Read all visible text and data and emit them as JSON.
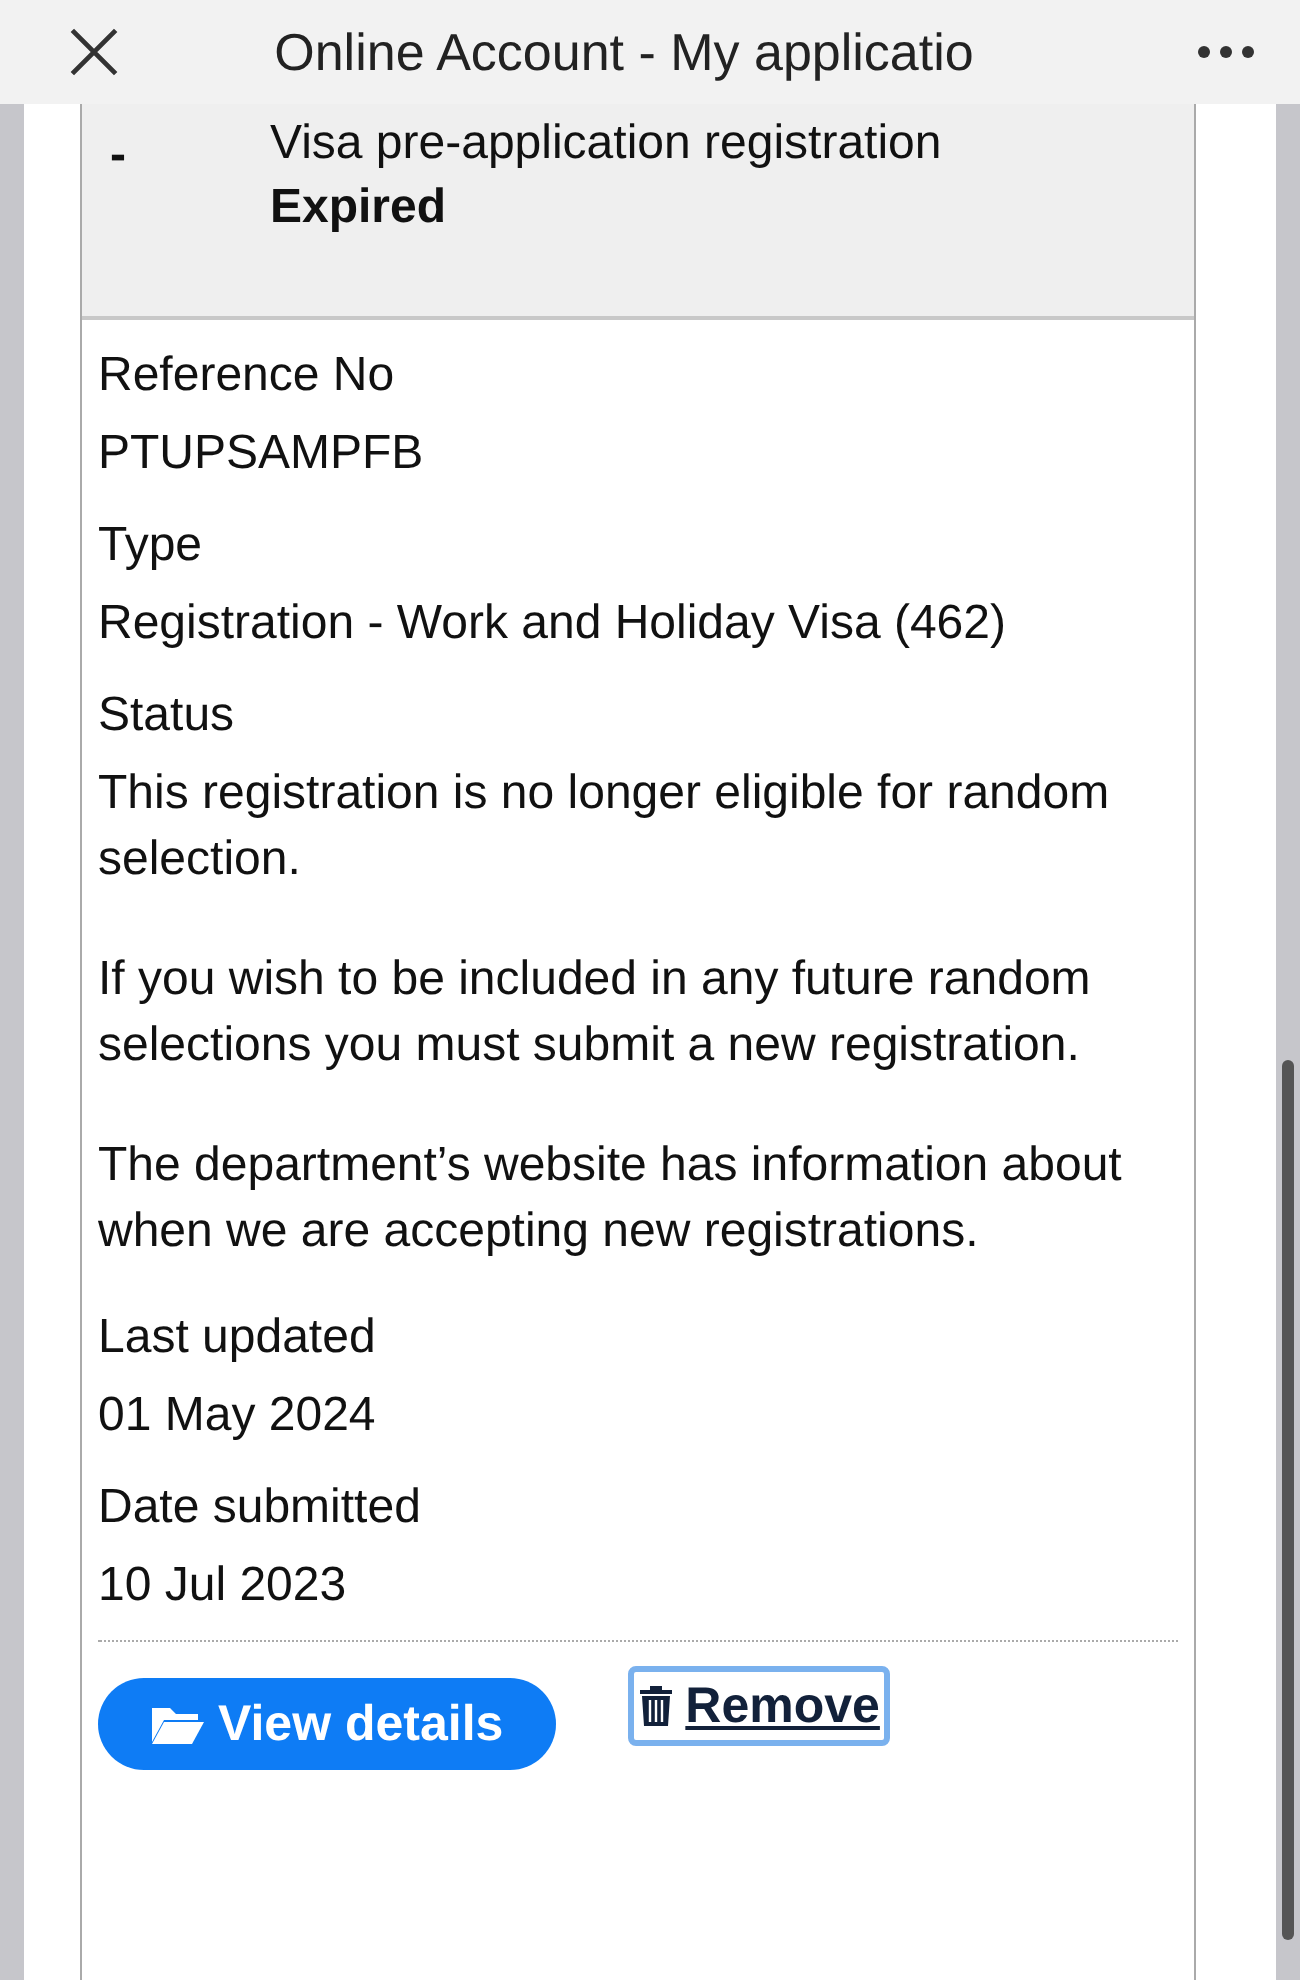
{
  "window": {
    "title": "Online Account - My applicatio"
  },
  "header": {
    "toggle": "-",
    "title": "Visa pre-application registration",
    "status": "Expired"
  },
  "fields": [
    {
      "label": "Reference No",
      "values": [
        "PTUPSAMPFB"
      ]
    },
    {
      "label": "Type",
      "values": [
        "Registration - Work and Holiday Visa (462)"
      ]
    },
    {
      "label": "Status",
      "values": [
        "This registration is no longer eligible for random selection.",
        "If you wish to be included in any future random selections you must submit a new registration.",
        "The department’s website has information about when we are accepting new registrations."
      ]
    },
    {
      "label": "Last updated",
      "values": [
        "01 May 2024"
      ]
    },
    {
      "label": "Date submitted",
      "values": [
        "10 Jul 2023"
      ]
    }
  ],
  "actions": [
    {
      "kind": "primary",
      "label": "View details",
      "focused": false
    },
    {
      "kind": "link",
      "label": "Remove",
      "focused": true
    }
  ]
}
